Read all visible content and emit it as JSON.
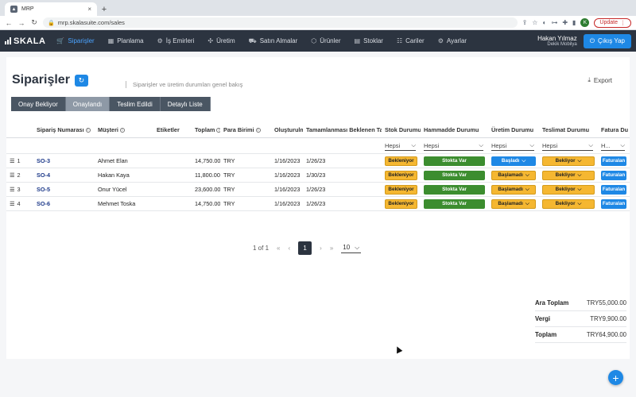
{
  "browser": {
    "tab_title": "MRP",
    "tab_close": "×",
    "new_tab": "+",
    "url": "mrp.skalasuite.com/sales",
    "profile_initial": "K",
    "update_label": "Update"
  },
  "appnav": {
    "logo": "SKALA",
    "items": [
      {
        "label": "Siparişler",
        "icon": "cart-icon",
        "glyph": "🛒",
        "active": true
      },
      {
        "label": "Planlama",
        "icon": "calendar-icon",
        "glyph": "▦",
        "active": false
      },
      {
        "label": "İş Emirleri",
        "icon": "clipboard-icon",
        "glyph": "⚙",
        "active": false
      },
      {
        "label": "Üretim",
        "icon": "factory-icon",
        "glyph": "✣",
        "active": false
      },
      {
        "label": "Satın Almalar",
        "icon": "truck-icon",
        "glyph": "⛟",
        "active": false
      },
      {
        "label": "Ürünler",
        "icon": "box-icon",
        "glyph": "⬡",
        "active": false
      },
      {
        "label": "Stoklar",
        "icon": "warehouse-icon",
        "glyph": "▤",
        "active": false
      },
      {
        "label": "Cariler",
        "icon": "contacts-icon",
        "glyph": "☷",
        "active": false
      },
      {
        "label": "Ayarlar",
        "icon": "gear-icon",
        "glyph": "⚙",
        "active": false
      }
    ],
    "user_name": "Hakan Yılmaz",
    "company": "Dekik Mobilya",
    "logout_label": "Çıkış Yap"
  },
  "page": {
    "title": "Siparişler",
    "subtitle": "Siparişler ve üretim durumları genel bakış",
    "export_label": "Export",
    "tabs": [
      {
        "label": "Onay Bekliyor",
        "selected": false
      },
      {
        "label": "Onaylandı",
        "selected": true
      },
      {
        "label": "Teslim Edildi",
        "selected": false
      },
      {
        "label": "Detaylı Liste",
        "selected": false
      }
    ]
  },
  "table": {
    "headers": [
      "",
      "Sipariş Numarası",
      "Müşteri",
      "Etiketler",
      "Toplam",
      "Para Birimi",
      "Oluşturulm",
      "Tamamlanması Beklenen Tari",
      "Stok Durumu",
      "Hammadde Durumu",
      "Üretim Durumu",
      "Teslimat Durumu",
      "Fatura Du"
    ],
    "filters": {
      "stock": "Hepsi",
      "material": "Hepsi",
      "production": "Hepsi",
      "delivery": "Hepsi",
      "invoice": "H..."
    },
    "rows": [
      {
        "idx": "1",
        "order": "SO-3",
        "customer": "Ahmet Elan",
        "total": "14,750.00",
        "currency": "TRY",
        "created": "1/16/2023",
        "due": "1/26/23",
        "stock": "Bekleniyor",
        "material": "Stokta Var",
        "production": "Başladı",
        "delivery": "Bekliyor",
        "invoice": "Faturalan"
      },
      {
        "idx": "2",
        "order": "SO-4",
        "customer": "Hakan Kaya",
        "total": "11,800.00",
        "currency": "TRY",
        "created": "1/16/2023",
        "due": "1/30/23",
        "stock": "Bekleniyor",
        "material": "Stokta Var",
        "production": "Başlamadı",
        "delivery": "Bekliyor",
        "invoice": "Faturalan"
      },
      {
        "idx": "3",
        "order": "SO-5",
        "customer": "Onur Yücel",
        "total": "23,600.00",
        "currency": "TRY",
        "created": "1/16/2023",
        "due": "1/26/23",
        "stock": "Bekleniyor",
        "material": "Stokta Var",
        "production": "Başlamadı",
        "delivery": "Bekliyor",
        "invoice": "Faturalan"
      },
      {
        "idx": "4",
        "order": "SO-6",
        "customer": "Mehmet Toska",
        "total": "14,750.00",
        "currency": "TRY",
        "created": "1/16/2023",
        "due": "1/26/23",
        "stock": "Bekleniyor",
        "material": "Stokta Var",
        "production": "Başlamadı",
        "delivery": "Bekliyor",
        "invoice": "Faturalan"
      }
    ]
  },
  "pager": {
    "info": "1 of 1",
    "current": "1",
    "page_size": "10"
  },
  "totals": {
    "subtotal_label": "Ara Toplam",
    "subtotal": "TRY55,000.00",
    "tax_label": "Vergi",
    "tax": "TRY9,900.00",
    "total_label": "Toplam",
    "total": "TRY64,900.00"
  },
  "colors": {
    "accent": "#1e88e5",
    "nav_bg": "#2c3440",
    "pending": "#f5b731",
    "in_stock": "#3c8d2f"
  }
}
